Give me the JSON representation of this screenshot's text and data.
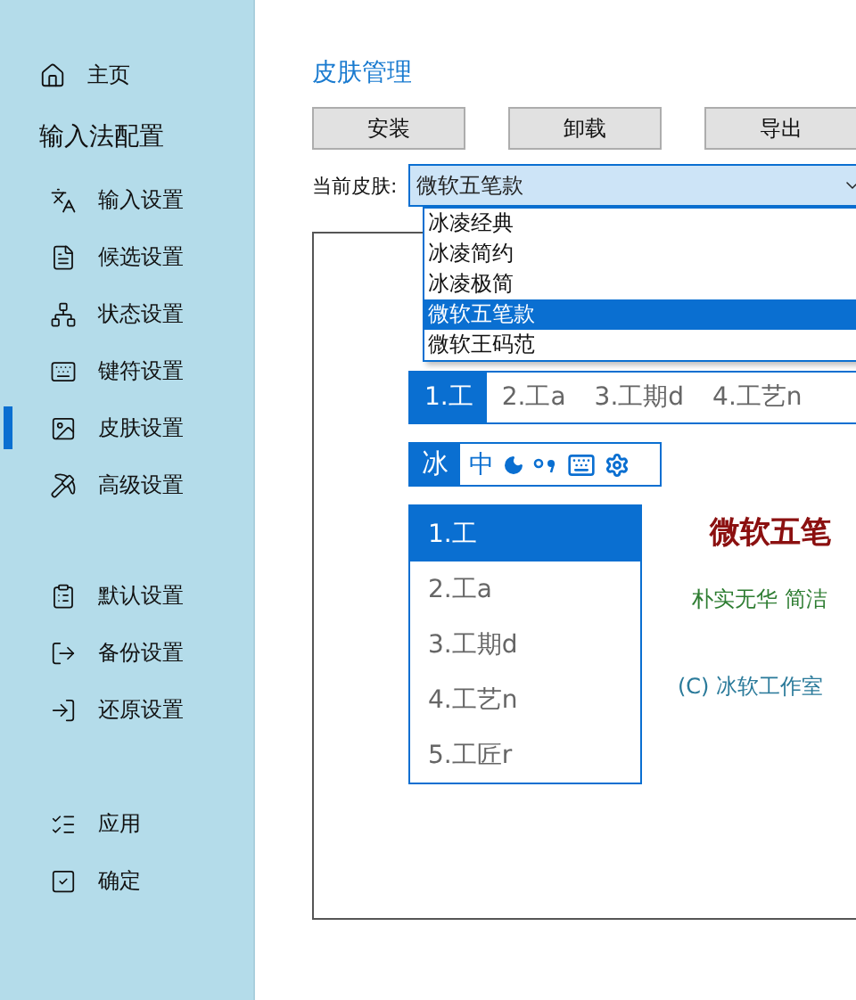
{
  "sidebar": {
    "home": {
      "label": "主页"
    },
    "section_title": "输入法配置",
    "groups": [
      [
        {
          "label": "输入设置",
          "selected": false
        },
        {
          "label": "候选设置",
          "selected": false
        },
        {
          "label": "状态设置",
          "selected": false
        },
        {
          "label": "键符设置",
          "selected": false
        },
        {
          "label": "皮肤设置",
          "selected": true
        },
        {
          "label": "高级设置",
          "selected": false
        }
      ],
      [
        {
          "label": "默认设置",
          "selected": false
        },
        {
          "label": "备份设置",
          "selected": false
        },
        {
          "label": "还原设置",
          "selected": false
        }
      ],
      [
        {
          "label": "应用",
          "selected": false
        },
        {
          "label": "确定",
          "selected": false
        }
      ]
    ]
  },
  "main": {
    "title": "皮肤管理",
    "buttons": [
      "安装",
      "卸载",
      "导出"
    ],
    "skin_selector": {
      "label": "当前皮肤:",
      "value": "微软五笔款",
      "expanded": true,
      "options": [
        {
          "label": "冰凌经典",
          "selected": false
        },
        {
          "label": "冰凌简约",
          "selected": false
        },
        {
          "label": "冰凌极简",
          "selected": false
        },
        {
          "label": "微软五笔款",
          "selected": true
        },
        {
          "label": "微软王码范",
          "selected": false
        }
      ]
    },
    "preview": {
      "horizontal_candidates": [
        {
          "label": "1.工",
          "selected": true
        },
        {
          "label": "2.工a",
          "selected": false
        },
        {
          "label": "3.工期d",
          "selected": false
        },
        {
          "label": "4.工艺n",
          "selected": false
        }
      ],
      "status_bar": {
        "logo": "冰",
        "mode": "中"
      },
      "vertical_candidates": [
        {
          "label": "1.工",
          "selected": true
        },
        {
          "label": "2.工a",
          "selected": false
        },
        {
          "label": "3.工期d",
          "selected": false
        },
        {
          "label": "4.工艺n",
          "selected": false
        },
        {
          "label": "5.工匠r",
          "selected": false
        }
      ],
      "skin_name": "微软五笔",
      "slogan": "朴实无华 简洁",
      "copyright": "(C) 冰软工作室"
    }
  }
}
